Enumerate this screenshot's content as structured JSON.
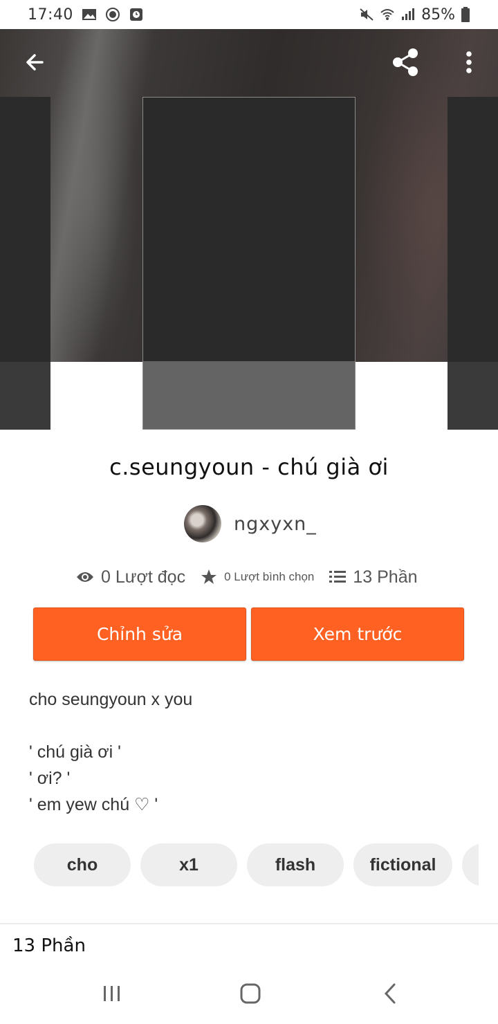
{
  "status_bar": {
    "time": "17:40",
    "battery": "85%",
    "icons": [
      "image-icon",
      "record-icon",
      "clock-icon",
      "mute-icon",
      "wifi-icon",
      "signal-icon",
      "battery-icon"
    ]
  },
  "toolbar": {
    "back_icon": "arrow-left-icon",
    "share_icon": "share-icon",
    "more_icon": "more-vertical-icon"
  },
  "story": {
    "title": "c.seungyoun - chú già ơi",
    "author": "ngxyxn_",
    "stats": {
      "reads": "0 Lượt đọc",
      "votes": "0 Lượt bình chọn",
      "parts": "13 Phần"
    },
    "buttons": {
      "edit": "Chỉnh sửa",
      "preview": "Xem trước"
    },
    "description": [
      "cho seungyoun x you",
      "",
      "' chú già ơi '",
      "' ơi? '",
      "' em yew chú ♡ '"
    ],
    "tags": [
      "cho",
      "x1",
      "flash",
      "fictional"
    ],
    "parts_heading": "13 Phần"
  },
  "colors": {
    "accent": "#ff6122",
    "tag_bg": "#eeeeee"
  }
}
